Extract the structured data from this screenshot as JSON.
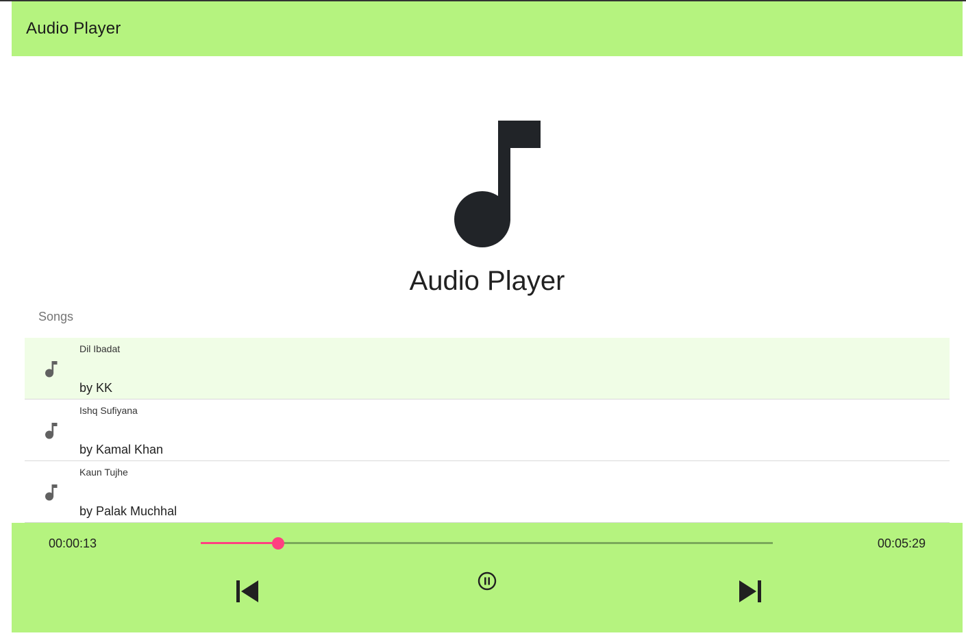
{
  "toolbar": {
    "title": "Audio Player"
  },
  "hero": {
    "title": "Audio Player",
    "icon": "music-note-icon"
  },
  "songs": {
    "header": "Songs",
    "items": [
      {
        "title": "Dil Ibadat",
        "artist": "by KK",
        "active": true
      },
      {
        "title": "Ishq Sufiyana",
        "artist": "by Kamal Khan",
        "active": false
      },
      {
        "title": "Kaun Tujhe",
        "artist": "by Palak Muchhal",
        "active": false
      }
    ]
  },
  "player": {
    "current_time": "00:00:13",
    "total_time": "00:05:29",
    "progress": 0.135,
    "controls": [
      "skip-previous-icon",
      "pause-circle-icon",
      "skip-next-icon"
    ]
  },
  "colors": {
    "bar": "#b5f37f",
    "accent": "#ff4081",
    "active_row": "#f0fde6"
  }
}
